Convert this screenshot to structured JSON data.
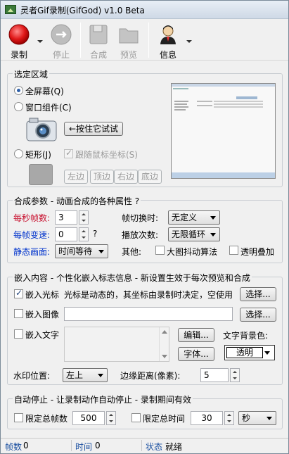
{
  "window": {
    "title": "灵者Gif录制(GifGod) v1.0 Beta"
  },
  "toolbar": {
    "record": "录制",
    "stop": "停止",
    "compose": "合成",
    "preview": "预览",
    "info": "信息"
  },
  "region": {
    "title": "选定区域",
    "fullscreen": "全屏幕(Q)",
    "window_component": "窗口组件(C)",
    "hold_to_try": "←按住它试试",
    "rectangle": "矩形(J)",
    "follow_mouse": "跟随鼠标坐标(S)",
    "left": "左边",
    "top": "顶边",
    "right": "右边",
    "bottom": "底边"
  },
  "compose": {
    "title": "合成参数 - 动画合成的各种属性  ?",
    "fps_label": "每秒帧数:",
    "fps_value": "3",
    "frame_switch_label": "帧切换时:",
    "frame_switch_value": "无定义",
    "speed_label": "每帧变速:",
    "speed_value": "0",
    "speed_help": "?",
    "play_count_label": "播放次数:",
    "play_count_value": "无限循环",
    "static_label": "静态画面:",
    "static_value": "时间等待",
    "other_label": "其他:",
    "dither": "大图抖动算法",
    "transparent": "透明叠加"
  },
  "embed": {
    "title": "嵌入内容 - 个性化嵌入标志信息 - 新设置生效于每次预览和合成",
    "cursor": "嵌入光标",
    "cursor_desc": "光标是动态的，其坐标由录制时决定，空使用",
    "choose1": "选择...",
    "image": "嵌入图像",
    "image_path": "",
    "choose2": "选择...",
    "text": "嵌入文字",
    "edit": "编辑...",
    "font": "字体...",
    "text_bg_label": "文字背景色:",
    "text_bg_value": "透明",
    "watermark_pos_label": "水印位置:",
    "watermark_pos_value": "左上",
    "margin_label": "边缘距离(像素):",
    "margin_value": "5"
  },
  "autostop": {
    "title": "自动停止 - 让录制动作自动停止 - 录制期间有效",
    "limit_frames": "限定总帧数",
    "frames_value": "500",
    "limit_time": "限定总时间",
    "time_value": "30",
    "unit": "秒"
  },
  "status": {
    "frames_label": "帧数",
    "frames_value": "0",
    "time_label": "时间",
    "time_value": "0",
    "state_label": "状态",
    "state_value": "就绪"
  },
  "colors": {
    "accent_red": "#c8102e",
    "accent_blue": "#0033cc",
    "label_blue": "#1a4fa0"
  }
}
